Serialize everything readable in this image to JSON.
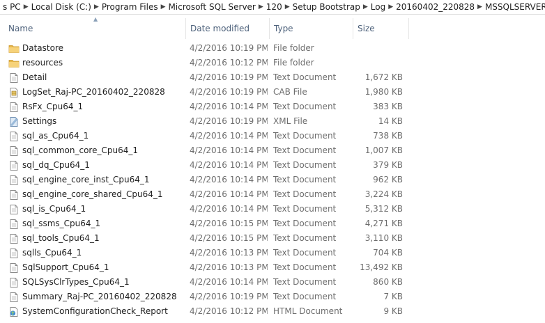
{
  "window": {
    "breadcrumb": [
      "s PC",
      "Local Disk (C:)",
      "Program Files",
      "Microsoft SQL Server",
      "120",
      "Setup Bootstrap",
      "Log",
      "20160402_220828",
      "MSSQLSERVER"
    ]
  },
  "columns": {
    "name": "Name",
    "date": "Date modified",
    "type": "Type",
    "size": "Size"
  },
  "files": [
    {
      "name": "Datastore",
      "date": "4/2/2016 10:19 PM",
      "type": "File folder",
      "size": "",
      "icon": "folder-icon"
    },
    {
      "name": "resources",
      "date": "4/2/2016 10:12 PM",
      "type": "File folder",
      "size": "",
      "icon": "folder-icon"
    },
    {
      "name": "Detail",
      "date": "4/2/2016 10:19 PM",
      "type": "Text Document",
      "size": "1,672 KB",
      "icon": "text-document-icon"
    },
    {
      "name": "LogSet_Raj-PC_20160402_220828",
      "date": "4/2/2016 10:19 PM",
      "type": "CAB File",
      "size": "1,980 KB",
      "icon": "cab-file-icon"
    },
    {
      "name": "RsFx_Cpu64_1",
      "date": "4/2/2016 10:14 PM",
      "type": "Text Document",
      "size": "383 KB",
      "icon": "text-document-icon"
    },
    {
      "name": "Settings",
      "date": "4/2/2016 10:19 PM",
      "type": "XML File",
      "size": "14 KB",
      "icon": "xml-file-icon"
    },
    {
      "name": "sql_as_Cpu64_1",
      "date": "4/2/2016 10:14 PM",
      "type": "Text Document",
      "size": "738 KB",
      "icon": "text-document-icon"
    },
    {
      "name": "sql_common_core_Cpu64_1",
      "date": "4/2/2016 10:14 PM",
      "type": "Text Document",
      "size": "1,007 KB",
      "icon": "text-document-icon"
    },
    {
      "name": "sql_dq_Cpu64_1",
      "date": "4/2/2016 10:14 PM",
      "type": "Text Document",
      "size": "379 KB",
      "icon": "text-document-icon"
    },
    {
      "name": "sql_engine_core_inst_Cpu64_1",
      "date": "4/2/2016 10:14 PM",
      "type": "Text Document",
      "size": "962 KB",
      "icon": "text-document-icon"
    },
    {
      "name": "sql_engine_core_shared_Cpu64_1",
      "date": "4/2/2016 10:14 PM",
      "type": "Text Document",
      "size": "3,224 KB",
      "icon": "text-document-icon"
    },
    {
      "name": "sql_is_Cpu64_1",
      "date": "4/2/2016 10:14 PM",
      "type": "Text Document",
      "size": "5,312 KB",
      "icon": "text-document-icon"
    },
    {
      "name": "sql_ssms_Cpu64_1",
      "date": "4/2/2016 10:15 PM",
      "type": "Text Document",
      "size": "4,271 KB",
      "icon": "text-document-icon"
    },
    {
      "name": "sql_tools_Cpu64_1",
      "date": "4/2/2016 10:15 PM",
      "type": "Text Document",
      "size": "3,110 KB",
      "icon": "text-document-icon"
    },
    {
      "name": "sqlls_Cpu64_1",
      "date": "4/2/2016 10:13 PM",
      "type": "Text Document",
      "size": "704 KB",
      "icon": "text-document-icon"
    },
    {
      "name": "SqlSupport_Cpu64_1",
      "date": "4/2/2016 10:13 PM",
      "type": "Text Document",
      "size": "13,492 KB",
      "icon": "text-document-icon"
    },
    {
      "name": "SQLSysClrTypes_Cpu64_1",
      "date": "4/2/2016 10:14 PM",
      "type": "Text Document",
      "size": "860 KB",
      "icon": "text-document-icon"
    },
    {
      "name": "Summary_Raj-PC_20160402_220828",
      "date": "4/2/2016 10:19 PM",
      "type": "Text Document",
      "size": "7 KB",
      "icon": "text-document-icon"
    },
    {
      "name": "SystemConfigurationCheck_Report",
      "date": "4/2/2016 10:12 PM",
      "type": "HTML Document",
      "size": "9 KB",
      "icon": "html-document-icon"
    }
  ],
  "colors": {
    "folder": "#e8b84a",
    "header_text": "#4c607a",
    "detail_text": "#6d6d6d"
  }
}
